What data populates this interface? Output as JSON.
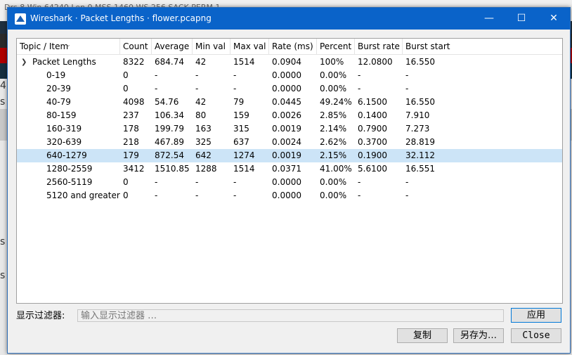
{
  "background": {
    "top_text": "Drs 8 Win 64240 Len 0 MSS 1460 WS 256 SACK PERM 1",
    "left_chars": [
      "4",
      "s",
      "s",
      "s"
    ]
  },
  "window": {
    "title": "Wireshark · Packet Lengths · flower.pcapng",
    "minimize_icon": "—",
    "maximize_icon": "☐",
    "close_icon": "✕"
  },
  "table": {
    "columns": [
      "Topic / Item",
      "Count",
      "Average",
      "Min val",
      "Max val",
      "Rate (ms)",
      "Percent",
      "Burst rate",
      "Burst start"
    ],
    "parent": {
      "topic": "Packet Lengths",
      "count": "8322",
      "average": "684.74",
      "min": "42",
      "max": "1514",
      "rate": "0.0904",
      "percent": "100%",
      "burst_rate": "12.0800",
      "burst_start": "16.550"
    },
    "rows": [
      {
        "topic": "0-19",
        "count": "0",
        "average": "-",
        "min": "-",
        "max": "-",
        "rate": "0.0000",
        "percent": "0.00%",
        "burst_rate": "-",
        "burst_start": "-"
      },
      {
        "topic": "20-39",
        "count": "0",
        "average": "-",
        "min": "-",
        "max": "-",
        "rate": "0.0000",
        "percent": "0.00%",
        "burst_rate": "-",
        "burst_start": "-"
      },
      {
        "topic": "40-79",
        "count": "4098",
        "average": "54.76",
        "min": "42",
        "max": "79",
        "rate": "0.0445",
        "percent": "49.24%",
        "burst_rate": "6.1500",
        "burst_start": "16.550"
      },
      {
        "topic": "80-159",
        "count": "237",
        "average": "106.34",
        "min": "80",
        "max": "159",
        "rate": "0.0026",
        "percent": "2.85%",
        "burst_rate": "0.1400",
        "burst_start": "7.910"
      },
      {
        "topic": "160-319",
        "count": "178",
        "average": "199.79",
        "min": "163",
        "max": "315",
        "rate": "0.0019",
        "percent": "2.14%",
        "burst_rate": "0.7900",
        "burst_start": "7.273"
      },
      {
        "topic": "320-639",
        "count": "218",
        "average": "467.89",
        "min": "325",
        "max": "637",
        "rate": "0.0024",
        "percent": "2.62%",
        "burst_rate": "0.3700",
        "burst_start": "28.819"
      },
      {
        "topic": "640-1279",
        "count": "179",
        "average": "872.54",
        "min": "642",
        "max": "1274",
        "rate": "0.0019",
        "percent": "2.15%",
        "burst_rate": "0.1900",
        "burst_start": "32.112"
      },
      {
        "topic": "1280-2559",
        "count": "3412",
        "average": "1510.85",
        "min": "1288",
        "max": "1514",
        "rate": "0.0371",
        "percent": "41.00%",
        "burst_rate": "5.6100",
        "burst_start": "16.551"
      },
      {
        "topic": "2560-5119",
        "count": "0",
        "average": "-",
        "min": "-",
        "max": "-",
        "rate": "0.0000",
        "percent": "0.00%",
        "burst_rate": "-",
        "burst_start": "-"
      },
      {
        "topic": "5120 and greater",
        "count": "0",
        "average": "-",
        "min": "-",
        "max": "-",
        "rate": "0.0000",
        "percent": "0.00%",
        "burst_rate": "-",
        "burst_start": "-"
      }
    ],
    "selected_row": "640-1279"
  },
  "filter": {
    "label": "显示过滤器:",
    "placeholder": "输入显示过滤器 …",
    "value": "",
    "apply_label": "应用"
  },
  "buttons": {
    "copy_label": "复制",
    "save_as_label": "另存为…",
    "close_label": "Close"
  },
  "colors": {
    "titlebar": "#0a63c9",
    "selection": "#cce4f7",
    "background_red": "#b00000"
  }
}
